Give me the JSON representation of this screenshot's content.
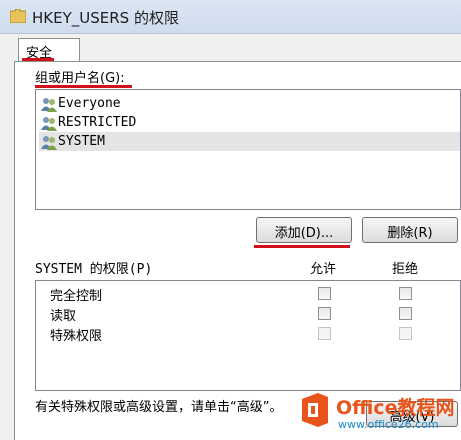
{
  "window": {
    "title": "HKEY_USERS 的权限"
  },
  "tabs": [
    {
      "label": "安全"
    }
  ],
  "group": {
    "label": "组或用户名(G):",
    "items": [
      {
        "name": "Everyone"
      },
      {
        "name": "RESTRICTED"
      },
      {
        "name": "SYSTEM",
        "selected": true
      }
    ]
  },
  "buttons": {
    "add": "添加(D)...",
    "remove": "删除(R)",
    "advanced": "高级(V)"
  },
  "permissions": {
    "label": "SYSTEM 的权限(P)",
    "allow_header": "允许",
    "deny_header": "拒绝",
    "rows": [
      {
        "name": "完全控制",
        "allow": false,
        "deny": false
      },
      {
        "name": "读取",
        "allow": false,
        "deny": false
      },
      {
        "name": "特殊权限",
        "allow": false,
        "deny": false
      }
    ]
  },
  "footer": {
    "text": "有关特殊权限或高级设置，请单击“高级”。"
  },
  "watermark": {
    "title": "Office教程网",
    "url": "www.office26.com"
  },
  "colors": {
    "annotation_red": "#d0101b",
    "watermark_orange": "#e9541b"
  }
}
